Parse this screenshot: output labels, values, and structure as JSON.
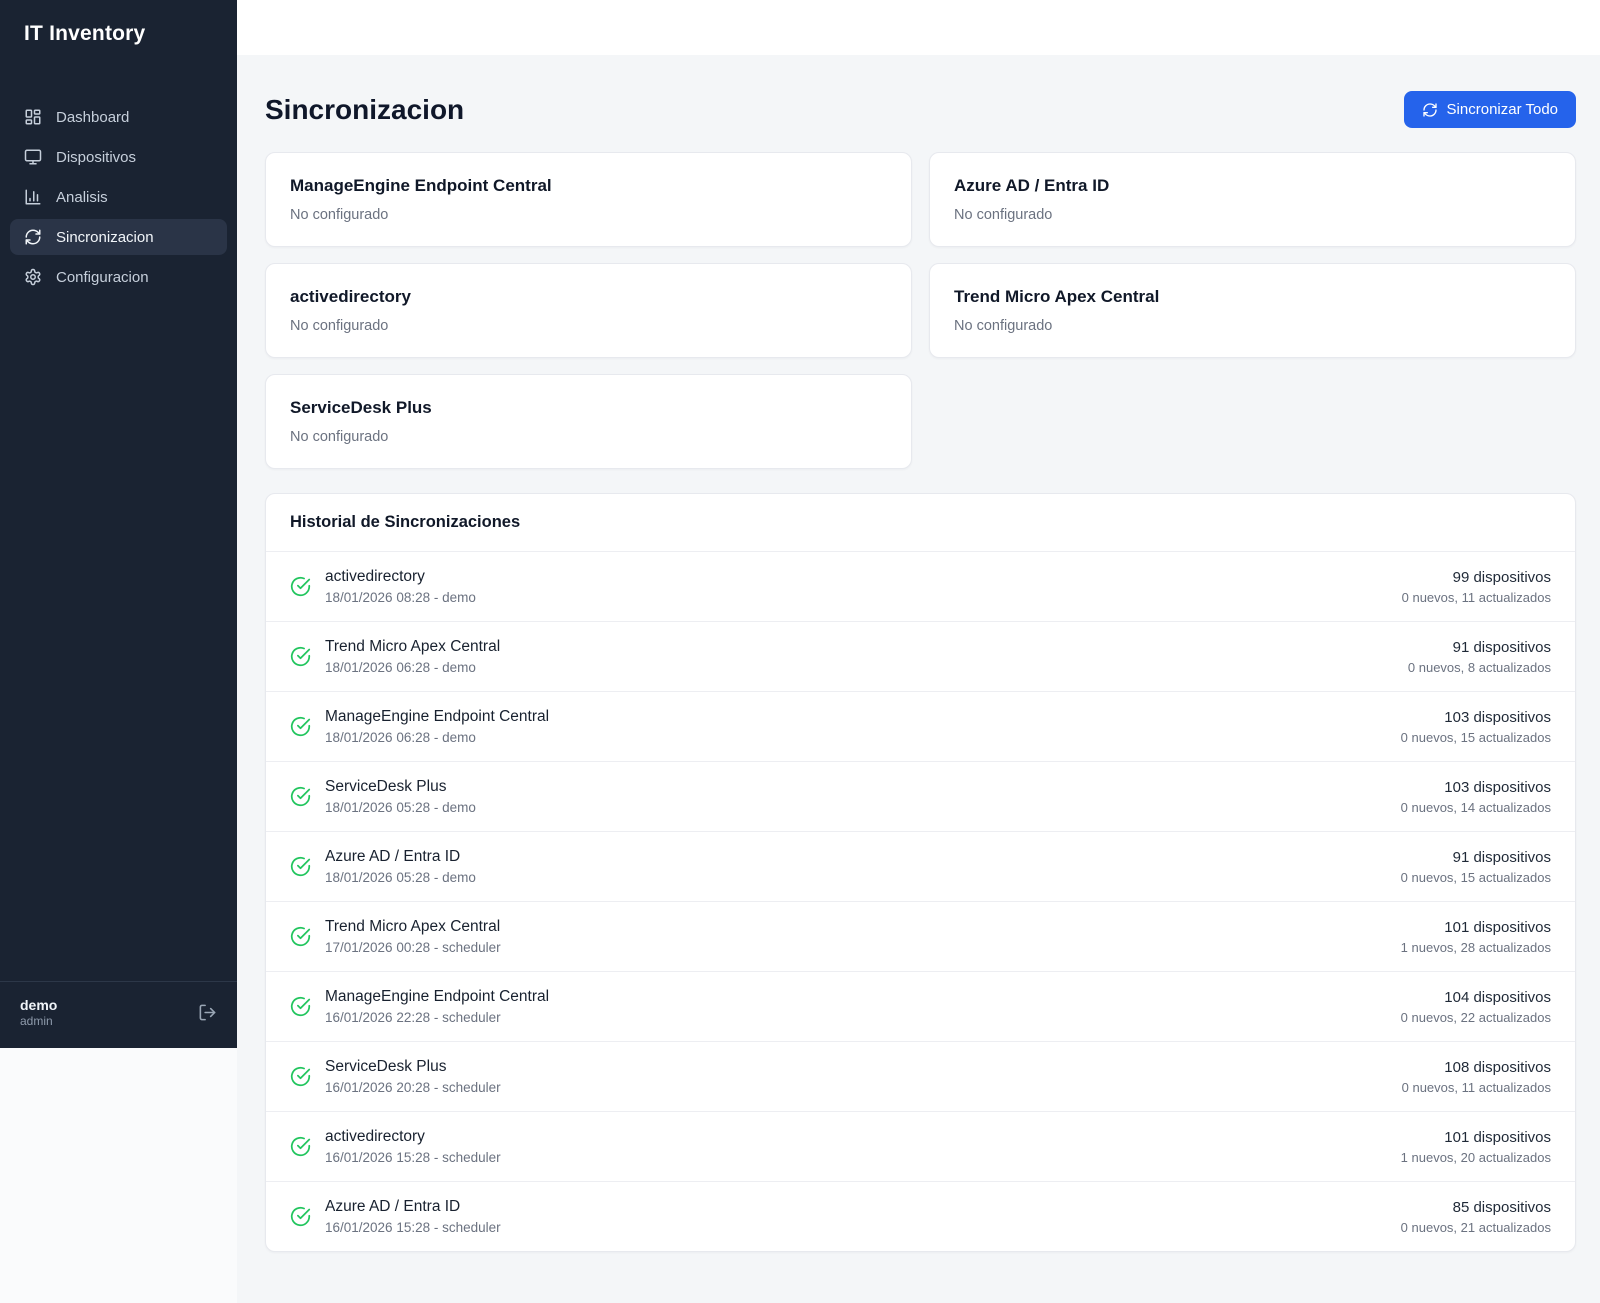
{
  "app": {
    "title": "IT Inventory"
  },
  "sidebar": {
    "items": [
      {
        "label": "Dashboard"
      },
      {
        "label": "Dispositivos"
      },
      {
        "label": "Analisis"
      },
      {
        "label": "Sincronizacion"
      },
      {
        "label": "Configuracion"
      }
    ],
    "user": {
      "name": "demo",
      "role": "admin"
    }
  },
  "header": {
    "title": "Sincronizacion",
    "sync_all_label": "Sincronizar Todo"
  },
  "sources": [
    {
      "name": "ManageEngine Endpoint Central",
      "status": "No configurado"
    },
    {
      "name": "Azure AD / Entra ID",
      "status": "No configurado"
    },
    {
      "name": "activedirectory",
      "status": "No configurado"
    },
    {
      "name": "Trend Micro Apex Central",
      "status": "No configurado"
    },
    {
      "name": "ServiceDesk Plus",
      "status": "No configurado"
    }
  ],
  "history": {
    "title": "Historial de Sincronizaciones",
    "entries": [
      {
        "name": "activedirectory",
        "datetime": "18/01/2026 08:28 - demo",
        "devices": "99 dispositivos",
        "details": "0 nuevos, 11 actualizados"
      },
      {
        "name": "Trend Micro Apex Central",
        "datetime": "18/01/2026 06:28 - demo",
        "devices": "91 dispositivos",
        "details": "0 nuevos, 8 actualizados"
      },
      {
        "name": "ManageEngine Endpoint Central",
        "datetime": "18/01/2026 06:28 - demo",
        "devices": "103 dispositivos",
        "details": "0 nuevos, 15 actualizados"
      },
      {
        "name": "ServiceDesk Plus",
        "datetime": "18/01/2026 05:28 - demo",
        "devices": "103 dispositivos",
        "details": "0 nuevos, 14 actualizados"
      },
      {
        "name": "Azure AD / Entra ID",
        "datetime": "18/01/2026 05:28 - demo",
        "devices": "91 dispositivos",
        "details": "0 nuevos, 15 actualizados"
      },
      {
        "name": "Trend Micro Apex Central",
        "datetime": "17/01/2026 00:28 - scheduler",
        "devices": "101 dispositivos",
        "details": "1 nuevos, 28 actualizados"
      },
      {
        "name": "ManageEngine Endpoint Central",
        "datetime": "16/01/2026 22:28 - scheduler",
        "devices": "104 dispositivos",
        "details": "0 nuevos, 22 actualizados"
      },
      {
        "name": "ServiceDesk Plus",
        "datetime": "16/01/2026 20:28 - scheduler",
        "devices": "108 dispositivos",
        "details": "0 nuevos, 11 actualizados"
      },
      {
        "name": "activedirectory",
        "datetime": "16/01/2026 15:28 - scheduler",
        "devices": "101 dispositivos",
        "details": "1 nuevos, 20 actualizados"
      },
      {
        "name": "Azure AD / Entra ID",
        "datetime": "16/01/2026 15:28 - scheduler",
        "devices": "85 dispositivos",
        "details": "0 nuevos, 21 actualizados"
      }
    ]
  },
  "colors": {
    "sidebar_bg": "#1a2332",
    "accent_blue": "#2563eb",
    "success_green": "#22c55e",
    "main_bg": "#f4f6f8"
  }
}
